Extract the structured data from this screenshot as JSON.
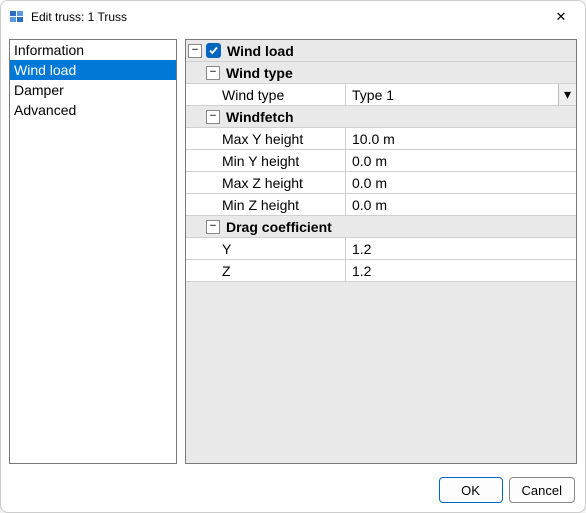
{
  "window": {
    "title": "Edit truss: 1 Truss"
  },
  "sidebar": {
    "items": [
      {
        "label": "Information",
        "selected": false
      },
      {
        "label": "Wind load",
        "selected": true
      },
      {
        "label": "Damper",
        "selected": false
      },
      {
        "label": "Advanced",
        "selected": false
      }
    ]
  },
  "propertygrid": {
    "section": {
      "label": "Wind load",
      "checked": true,
      "groups": [
        {
          "label": "Wind type",
          "rows": [
            {
              "name": "Wind type",
              "value": "Type 1",
              "kind": "dropdown"
            }
          ]
        },
        {
          "label": "Windfetch",
          "rows": [
            {
              "name": "Max Y height",
              "value": "10.0 m",
              "kind": "text"
            },
            {
              "name": "Min Y height",
              "value": "0.0 m",
              "kind": "text"
            },
            {
              "name": "Max Z height",
              "value": "0.0 m",
              "kind": "text"
            },
            {
              "name": "Min Z height",
              "value": "0.0 m",
              "kind": "text"
            }
          ]
        },
        {
          "label": "Drag coefficient",
          "rows": [
            {
              "name": "Y",
              "value": "1.2",
              "kind": "text"
            },
            {
              "name": "Z",
              "value": "1.2",
              "kind": "text"
            }
          ]
        }
      ]
    }
  },
  "footer": {
    "ok_label": "OK",
    "cancel_label": "Cancel"
  },
  "glyphs": {
    "minus": "−",
    "x": "✕",
    "check": "✓",
    "chevdown": "▾"
  }
}
